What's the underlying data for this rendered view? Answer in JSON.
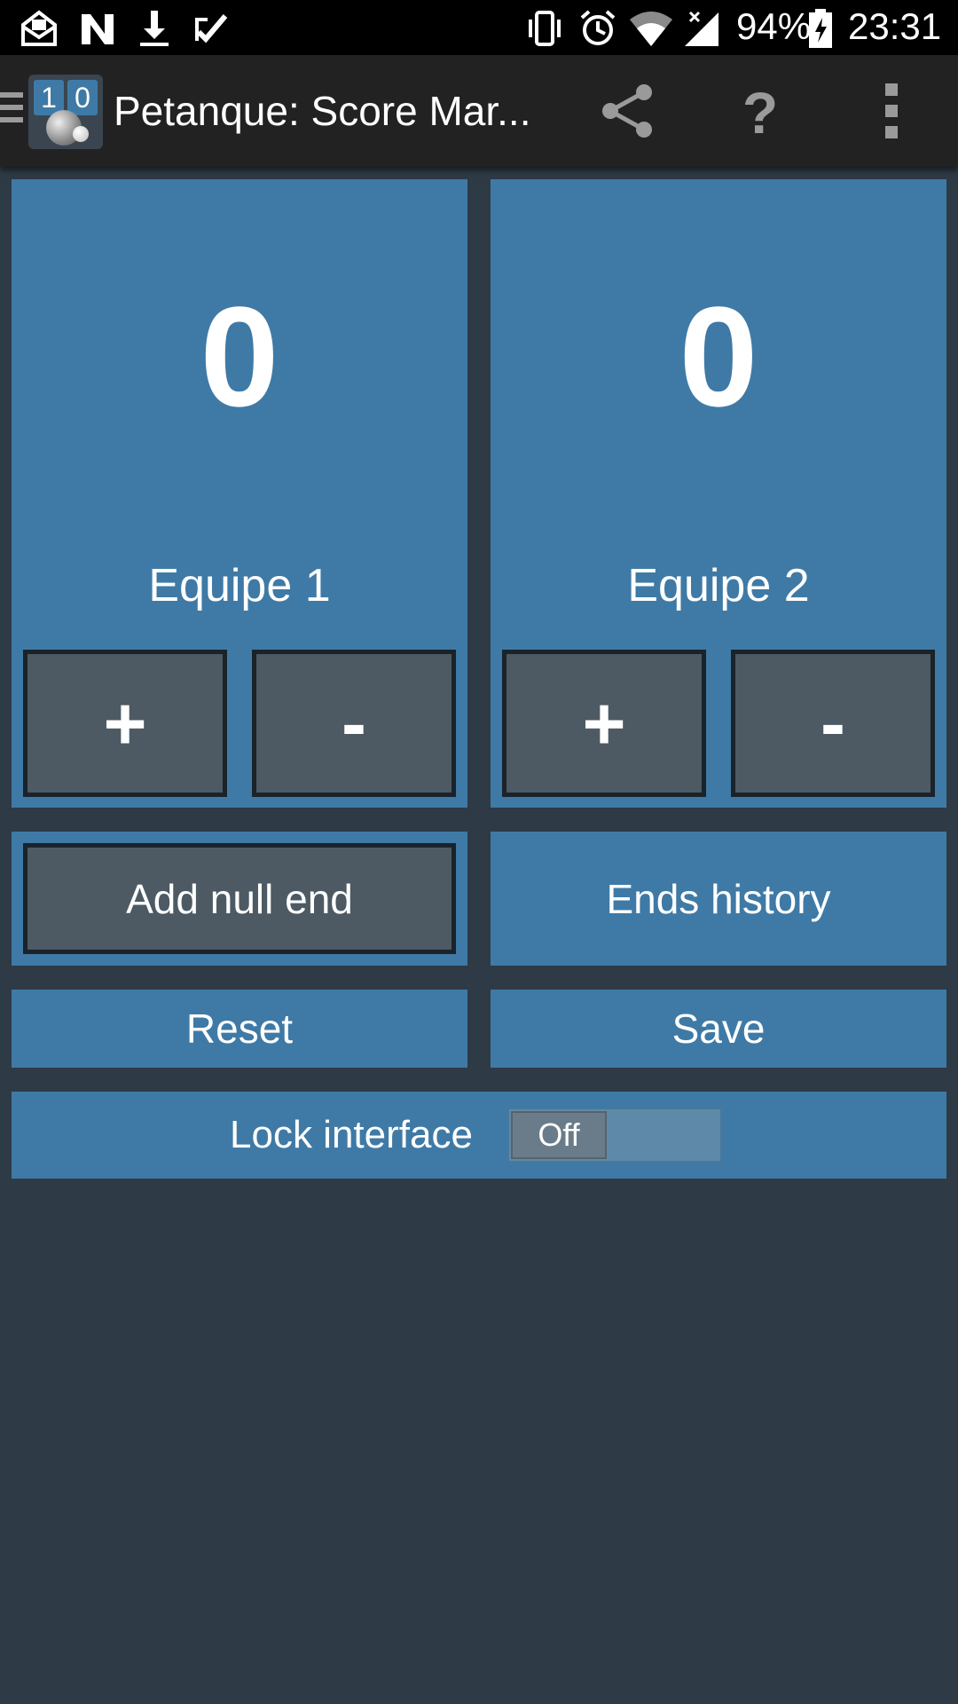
{
  "status_bar": {
    "battery": "94%",
    "time": "23:31",
    "icons": [
      "gmail-icon",
      "n-icon",
      "download-icon",
      "check-icon",
      "vibrate-icon",
      "alarm-icon",
      "wifi-icon",
      "signal-icon",
      "battery-icon"
    ]
  },
  "app_bar": {
    "title": "Petanque: Score Mar...",
    "logo_digits": [
      "1",
      "0"
    ],
    "actions": [
      "share-icon",
      "help-icon",
      "overflow-menu-icon"
    ]
  },
  "teams": [
    {
      "name": "Equipe 1",
      "score": "0",
      "plus_label": "+",
      "minus_label": "-"
    },
    {
      "name": "Equipe 2",
      "score": "0",
      "plus_label": "+",
      "minus_label": "-"
    }
  ],
  "actions": {
    "add_null_end": "Add null end",
    "ends_history": "Ends history",
    "reset": "Reset",
    "save": "Save"
  },
  "lock": {
    "label": "Lock interface",
    "toggle_state": "Off"
  },
  "colors": {
    "panel": "#3f7aa6",
    "background": "#2e3a45",
    "button_dark": "#4d5a63",
    "app_bar": "#222222"
  }
}
